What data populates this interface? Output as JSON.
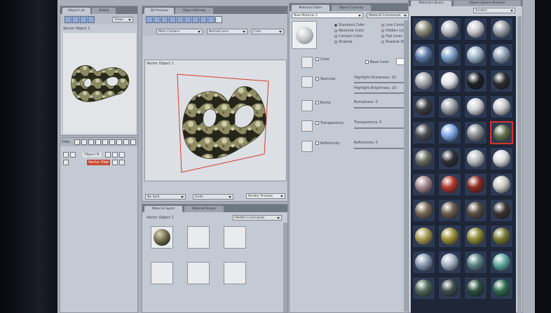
{
  "object_list_panel": {
    "tabs": [
      "Object List",
      "Global"
    ],
    "views_select": "Views",
    "title": "Vector Object 1"
  },
  "layers_panel": {
    "label_left": "Dele",
    "object_label": "Object N",
    "layer_label": "Vector Obje"
  },
  "preview_panel": {
    "tabs": [
      "3D Preview",
      "Object Bitmap"
    ],
    "camera_select": "Main Camera",
    "lens_select": "Normal Lens",
    "extra_select": "Cam",
    "viewport_title": "Vector Object 1",
    "split_select": "No Split",
    "grids_select": "Grids",
    "render_button": "Render Preview"
  },
  "material_spots_panel": {
    "tabs": [
      "Material Spots",
      "Material Books"
    ],
    "object_name": "Vector Object 1",
    "palette_select": "Palette Commands"
  },
  "material_editor_panel": {
    "tabs": [
      "Material Editor",
      "Object Controls"
    ],
    "material_name": "New Material 2",
    "commands_select": "Material Commands",
    "shading_options_left": [
      "Standard Color",
      "Absolute Color",
      "Cartoon Color",
      "Shadow"
    ],
    "shading_options_right": [
      "Line Contour",
      "Hidden Line",
      "Flat Lines",
      "Shadow Dr"
    ],
    "channels": [
      {
        "label": "Color",
        "checked": true,
        "extra": "Base Color"
      },
      {
        "label": "Specular",
        "checked": true,
        "sliders": [
          "Highlight Sharpness: 10",
          "Highlight Brightness: 10"
        ]
      },
      {
        "label": "Bump",
        "checked": true,
        "sliders": [
          "Bumpiness: 0"
        ]
      },
      {
        "label": "Transparency",
        "checked": true,
        "sliders": [
          "Transparency: 0"
        ]
      },
      {
        "label": "Reflectivity",
        "checked": true,
        "sliders": [
          "Reflectivity: 0"
        ]
      }
    ]
  },
  "material_library_panel": {
    "tabs": [
      "Material Library",
      "Object Library Browser"
    ],
    "category_select": "Scratch",
    "selected_index": 19,
    "spheres": [
      "#8a8a7a",
      "#b8bcc4",
      "#c7c9cc",
      "#9aa0a8",
      "#5b7aa6",
      "#7ea2c8",
      "#9fb6cc",
      "#8fa3b5",
      "#a7aaae",
      "#e3e4e6",
      "#1e1f22",
      "#2b2c30",
      "#3a3c40",
      "#9ea3a8",
      "#cfd2d5",
      "#c4c6c9",
      "#4a4e54",
      "#7fa8e8",
      "#8a8d91",
      "#5f6d4c",
      "#6a6b62",
      "#2d2f33",
      "#b9bcc0",
      "#d8dadc",
      "#a6888f",
      "#b2392c",
      "#8c2b22",
      "#c8c8c4",
      "#7b6a55",
      "#6e5e4e",
      "#5b4e42",
      "#3b3531",
      "#a79a52",
      "#9e9035",
      "#8c8a34",
      "#787a30",
      "#8b9bb3",
      "#a4b4c0",
      "#5c8484",
      "#5fa8a0",
      "#4f6a58",
      "#3e4c4a",
      "#2a4e3e",
      "#2d6a4a"
    ]
  }
}
